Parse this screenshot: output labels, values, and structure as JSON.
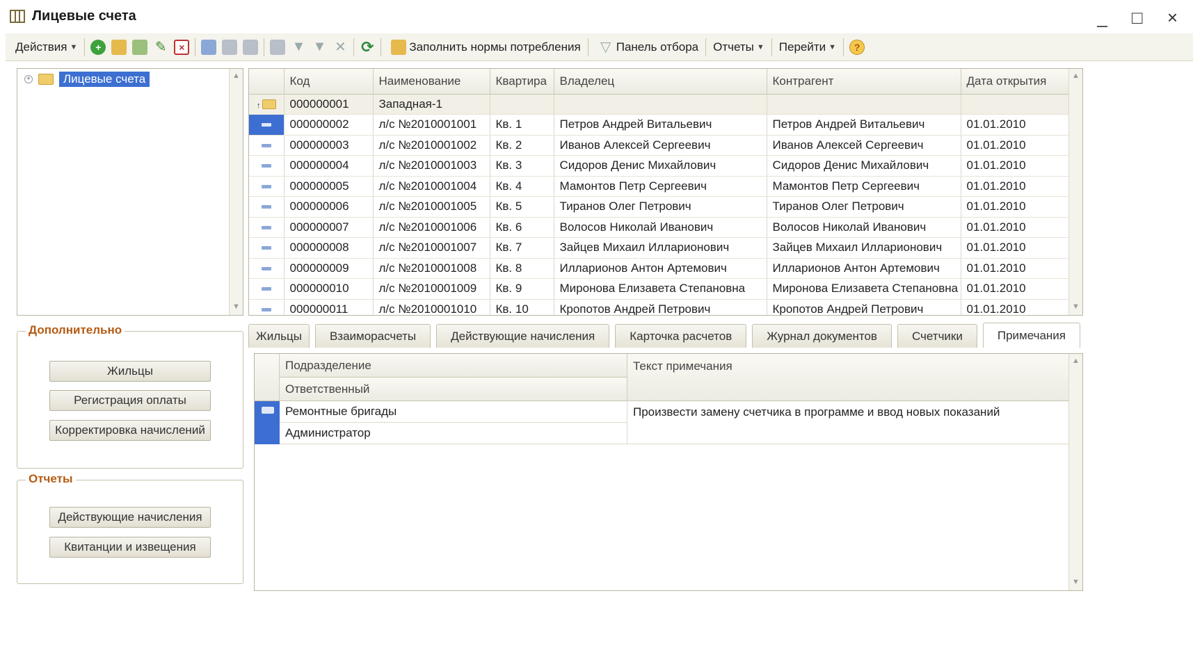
{
  "window": {
    "title": "Лицевые счета",
    "controls": "_ □ ×"
  },
  "toolbar": {
    "actions": "Действия",
    "fill_norms": "Заполнить нормы потребления",
    "filter_panel": "Панель отбора",
    "reports": "Отчеты",
    "go_to": "Перейти",
    "help": "?"
  },
  "tree": {
    "root_label": "Лицевые счета"
  },
  "extra": {
    "title": "Дополнительно",
    "buttons": [
      "Жильцы",
      "Регистрация оплаты",
      "Корректировка начислений"
    ]
  },
  "reports_group": {
    "title": "Отчеты",
    "buttons": [
      "Действующие начисления",
      "Квитанции и извещения"
    ]
  },
  "grid": {
    "columns": [
      "Код",
      "Наименование",
      "Квартира",
      "Владелец",
      "Контрагент",
      "Дата открытия"
    ],
    "group_row": {
      "code": "000000001",
      "name": "Западная-1"
    },
    "rows": [
      [
        "000000002",
        "л/с №2010001001",
        "Кв. 1",
        "Петров Андрей Витальевич",
        "Петров Андрей Витальевич",
        "01.01.2010"
      ],
      [
        "000000003",
        "л/с №2010001002",
        "Кв. 2",
        "Иванов Алексей Сергеевич",
        "Иванов Алексей Сергеевич",
        "01.01.2010"
      ],
      [
        "000000004",
        "л/с №2010001003",
        "Кв. 3",
        "Сидоров Денис Михайлович",
        "Сидоров Денис Михайлович",
        "01.01.2010"
      ],
      [
        "000000005",
        "л/с №2010001004",
        "Кв. 4",
        "Мамонтов Петр Сергеевич",
        "Мамонтов Петр Сергеевич",
        "01.01.2010"
      ],
      [
        "000000006",
        "л/с №2010001005",
        "Кв. 5",
        "Тиранов Олег Петрович",
        "Тиранов Олег Петрович",
        "01.01.2010"
      ],
      [
        "000000007",
        "л/с №2010001006",
        "Кв. 6",
        "Волосов Николай Иванович",
        "Волосов Николай Иванович",
        "01.01.2010"
      ],
      [
        "000000008",
        "л/с №2010001007",
        "Кв. 7",
        "Зайцев Михаил Илларионович",
        "Зайцев Михаил Илларионович",
        "01.01.2010"
      ],
      [
        "000000009",
        "л/с №2010001008",
        "Кв. 8",
        "Илларионов Антон Артемович",
        "Илларионов Антон Артемович",
        "01.01.2010"
      ],
      [
        "000000010",
        "л/с №2010001009",
        "Кв. 9",
        "Миронова Елизавета Степановна",
        "Миронова Елизавета Степановна",
        "01.01.2010"
      ],
      [
        "000000011",
        "л/с №2010001010",
        "Кв. 10",
        "Кропотов Андрей Петрович",
        "Кропотов Андрей Петрович",
        "01.01.2010"
      ]
    ]
  },
  "tabs": [
    "Жильцы",
    "Взаиморасчеты",
    "Действующие начисления",
    "Карточка расчетов",
    "Журнал документов",
    "Счетчики",
    "Примечания"
  ],
  "active_tab": "Примечания",
  "notes": {
    "col_division": "Подразделение",
    "col_responsible": "Ответственный",
    "col_text": "Текст примечания",
    "row": {
      "division": "Ремонтные бригады",
      "responsible": "Администратор",
      "text": "Произвести замену счетчика в программе и ввод новых показаний"
    }
  }
}
